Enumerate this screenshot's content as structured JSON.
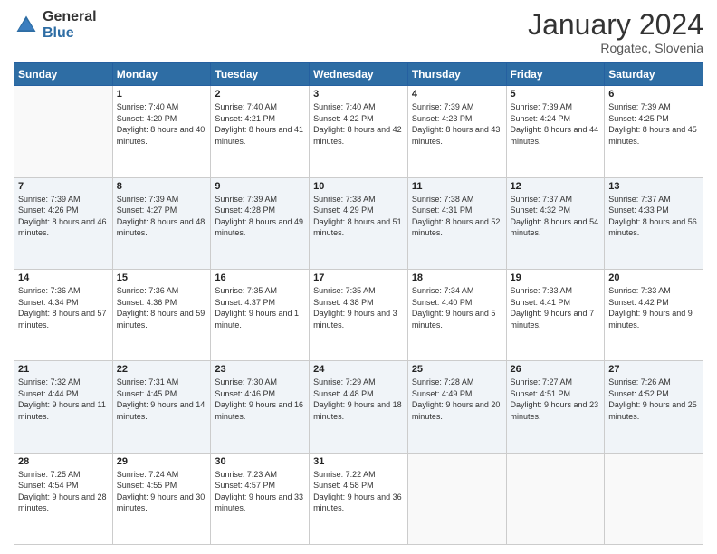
{
  "header": {
    "logo_general": "General",
    "logo_blue": "Blue",
    "month_title": "January 2024",
    "location": "Rogatec, Slovenia"
  },
  "weekdays": [
    "Sunday",
    "Monday",
    "Tuesday",
    "Wednesday",
    "Thursday",
    "Friday",
    "Saturday"
  ],
  "weeks": [
    [
      {
        "day": "",
        "sunrise": "",
        "sunset": "",
        "daylight": ""
      },
      {
        "day": "1",
        "sunrise": "Sunrise: 7:40 AM",
        "sunset": "Sunset: 4:20 PM",
        "daylight": "Daylight: 8 hours and 40 minutes."
      },
      {
        "day": "2",
        "sunrise": "Sunrise: 7:40 AM",
        "sunset": "Sunset: 4:21 PM",
        "daylight": "Daylight: 8 hours and 41 minutes."
      },
      {
        "day": "3",
        "sunrise": "Sunrise: 7:40 AM",
        "sunset": "Sunset: 4:22 PM",
        "daylight": "Daylight: 8 hours and 42 minutes."
      },
      {
        "day": "4",
        "sunrise": "Sunrise: 7:39 AM",
        "sunset": "Sunset: 4:23 PM",
        "daylight": "Daylight: 8 hours and 43 minutes."
      },
      {
        "day": "5",
        "sunrise": "Sunrise: 7:39 AM",
        "sunset": "Sunset: 4:24 PM",
        "daylight": "Daylight: 8 hours and 44 minutes."
      },
      {
        "day": "6",
        "sunrise": "Sunrise: 7:39 AM",
        "sunset": "Sunset: 4:25 PM",
        "daylight": "Daylight: 8 hours and 45 minutes."
      }
    ],
    [
      {
        "day": "7",
        "sunrise": "Sunrise: 7:39 AM",
        "sunset": "Sunset: 4:26 PM",
        "daylight": "Daylight: 8 hours and 46 minutes."
      },
      {
        "day": "8",
        "sunrise": "Sunrise: 7:39 AM",
        "sunset": "Sunset: 4:27 PM",
        "daylight": "Daylight: 8 hours and 48 minutes."
      },
      {
        "day": "9",
        "sunrise": "Sunrise: 7:39 AM",
        "sunset": "Sunset: 4:28 PM",
        "daylight": "Daylight: 8 hours and 49 minutes."
      },
      {
        "day": "10",
        "sunrise": "Sunrise: 7:38 AM",
        "sunset": "Sunset: 4:29 PM",
        "daylight": "Daylight: 8 hours and 51 minutes."
      },
      {
        "day": "11",
        "sunrise": "Sunrise: 7:38 AM",
        "sunset": "Sunset: 4:31 PM",
        "daylight": "Daylight: 8 hours and 52 minutes."
      },
      {
        "day": "12",
        "sunrise": "Sunrise: 7:37 AM",
        "sunset": "Sunset: 4:32 PM",
        "daylight": "Daylight: 8 hours and 54 minutes."
      },
      {
        "day": "13",
        "sunrise": "Sunrise: 7:37 AM",
        "sunset": "Sunset: 4:33 PM",
        "daylight": "Daylight: 8 hours and 56 minutes."
      }
    ],
    [
      {
        "day": "14",
        "sunrise": "Sunrise: 7:36 AM",
        "sunset": "Sunset: 4:34 PM",
        "daylight": "Daylight: 8 hours and 57 minutes."
      },
      {
        "day": "15",
        "sunrise": "Sunrise: 7:36 AM",
        "sunset": "Sunset: 4:36 PM",
        "daylight": "Daylight: 8 hours and 59 minutes."
      },
      {
        "day": "16",
        "sunrise": "Sunrise: 7:35 AM",
        "sunset": "Sunset: 4:37 PM",
        "daylight": "Daylight: 9 hours and 1 minute."
      },
      {
        "day": "17",
        "sunrise": "Sunrise: 7:35 AM",
        "sunset": "Sunset: 4:38 PM",
        "daylight": "Daylight: 9 hours and 3 minutes."
      },
      {
        "day": "18",
        "sunrise": "Sunrise: 7:34 AM",
        "sunset": "Sunset: 4:40 PM",
        "daylight": "Daylight: 9 hours and 5 minutes."
      },
      {
        "day": "19",
        "sunrise": "Sunrise: 7:33 AM",
        "sunset": "Sunset: 4:41 PM",
        "daylight": "Daylight: 9 hours and 7 minutes."
      },
      {
        "day": "20",
        "sunrise": "Sunrise: 7:33 AM",
        "sunset": "Sunset: 4:42 PM",
        "daylight": "Daylight: 9 hours and 9 minutes."
      }
    ],
    [
      {
        "day": "21",
        "sunrise": "Sunrise: 7:32 AM",
        "sunset": "Sunset: 4:44 PM",
        "daylight": "Daylight: 9 hours and 11 minutes."
      },
      {
        "day": "22",
        "sunrise": "Sunrise: 7:31 AM",
        "sunset": "Sunset: 4:45 PM",
        "daylight": "Daylight: 9 hours and 14 minutes."
      },
      {
        "day": "23",
        "sunrise": "Sunrise: 7:30 AM",
        "sunset": "Sunset: 4:46 PM",
        "daylight": "Daylight: 9 hours and 16 minutes."
      },
      {
        "day": "24",
        "sunrise": "Sunrise: 7:29 AM",
        "sunset": "Sunset: 4:48 PM",
        "daylight": "Daylight: 9 hours and 18 minutes."
      },
      {
        "day": "25",
        "sunrise": "Sunrise: 7:28 AM",
        "sunset": "Sunset: 4:49 PM",
        "daylight": "Daylight: 9 hours and 20 minutes."
      },
      {
        "day": "26",
        "sunrise": "Sunrise: 7:27 AM",
        "sunset": "Sunset: 4:51 PM",
        "daylight": "Daylight: 9 hours and 23 minutes."
      },
      {
        "day": "27",
        "sunrise": "Sunrise: 7:26 AM",
        "sunset": "Sunset: 4:52 PM",
        "daylight": "Daylight: 9 hours and 25 minutes."
      }
    ],
    [
      {
        "day": "28",
        "sunrise": "Sunrise: 7:25 AM",
        "sunset": "Sunset: 4:54 PM",
        "daylight": "Daylight: 9 hours and 28 minutes."
      },
      {
        "day": "29",
        "sunrise": "Sunrise: 7:24 AM",
        "sunset": "Sunset: 4:55 PM",
        "daylight": "Daylight: 9 hours and 30 minutes."
      },
      {
        "day": "30",
        "sunrise": "Sunrise: 7:23 AM",
        "sunset": "Sunset: 4:57 PM",
        "daylight": "Daylight: 9 hours and 33 minutes."
      },
      {
        "day": "31",
        "sunrise": "Sunrise: 7:22 AM",
        "sunset": "Sunset: 4:58 PM",
        "daylight": "Daylight: 9 hours and 36 minutes."
      },
      {
        "day": "",
        "sunrise": "",
        "sunset": "",
        "daylight": ""
      },
      {
        "day": "",
        "sunrise": "",
        "sunset": "",
        "daylight": ""
      },
      {
        "day": "",
        "sunrise": "",
        "sunset": "",
        "daylight": ""
      }
    ]
  ]
}
